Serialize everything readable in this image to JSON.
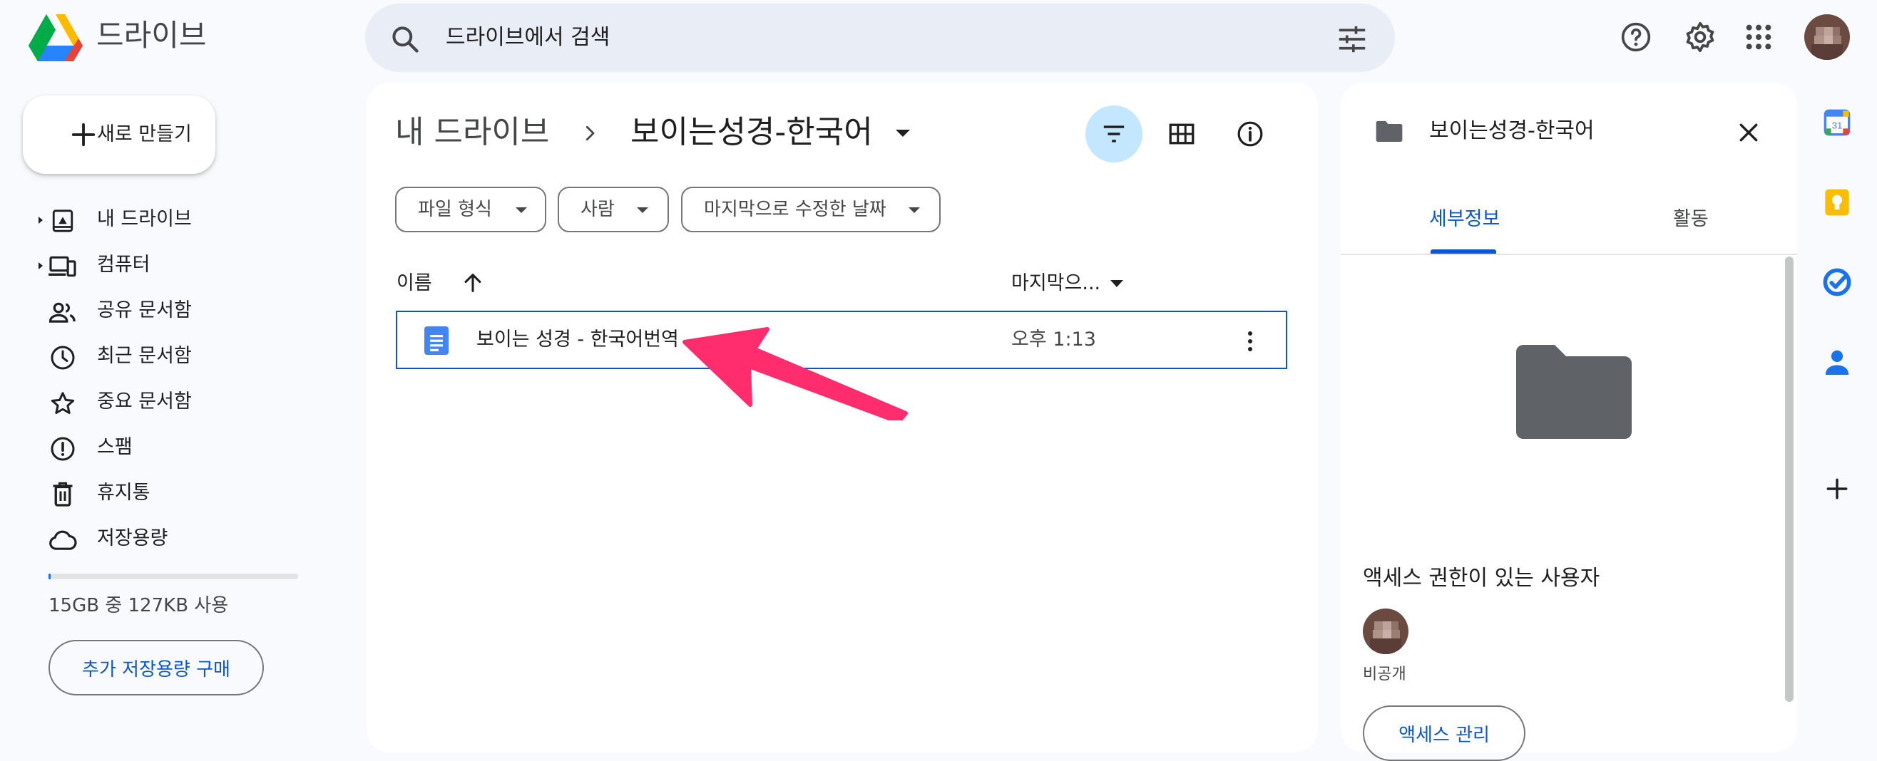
{
  "header": {
    "app_title": "드라이브",
    "search_placeholder": "드라이브에서 검색"
  },
  "sidebar": {
    "new_button_label": "새로 만들기",
    "items": [
      {
        "label": "내 드라이브",
        "icon": "my-drive-icon"
      },
      {
        "label": "컴퓨터",
        "icon": "computer-icon"
      },
      {
        "label": "공유 문서함",
        "icon": "shared-people-icon"
      },
      {
        "label": "최근 문서함",
        "icon": "clock-icon"
      },
      {
        "label": "중요 문서함",
        "icon": "star-icon"
      },
      {
        "label": "스팸",
        "icon": "spam-icon"
      },
      {
        "label": "휴지통",
        "icon": "trash-icon"
      },
      {
        "label": "저장용량",
        "icon": "cloud-icon"
      }
    ],
    "storage_text": "15GB 중 127KB 사용",
    "storage_used_fraction": 8e-06,
    "buy_storage_label": "추가 저장용량 구매"
  },
  "main": {
    "breadcrumb_root": "내 드라이브",
    "breadcrumb_current": "보이는성경-한국어",
    "filters": [
      "파일 형식",
      "사람",
      "마지막으로 수정한 날짜"
    ],
    "columns": {
      "name": "이름",
      "modified": "마지막으..."
    },
    "files": [
      {
        "name": "보이는 성경 - 한국어번역",
        "modified": "오후 1:13",
        "icon": "google-docs-icon"
      }
    ]
  },
  "details": {
    "title": "보이는성경-한국어",
    "tabs": [
      "세부정보",
      "활동"
    ],
    "access_title": "액세스 권한이 있는 사용자",
    "access_status": "비공개",
    "manage_button": "액세스 관리"
  },
  "rail": {
    "calendar_day": "31"
  },
  "colors": {
    "background": "#f8fafd",
    "accent": "#0b57d0",
    "search_bg": "#e9eef6",
    "selected_chip": "#c2e7ff",
    "annotation_arrow": "#ff2d6d"
  }
}
